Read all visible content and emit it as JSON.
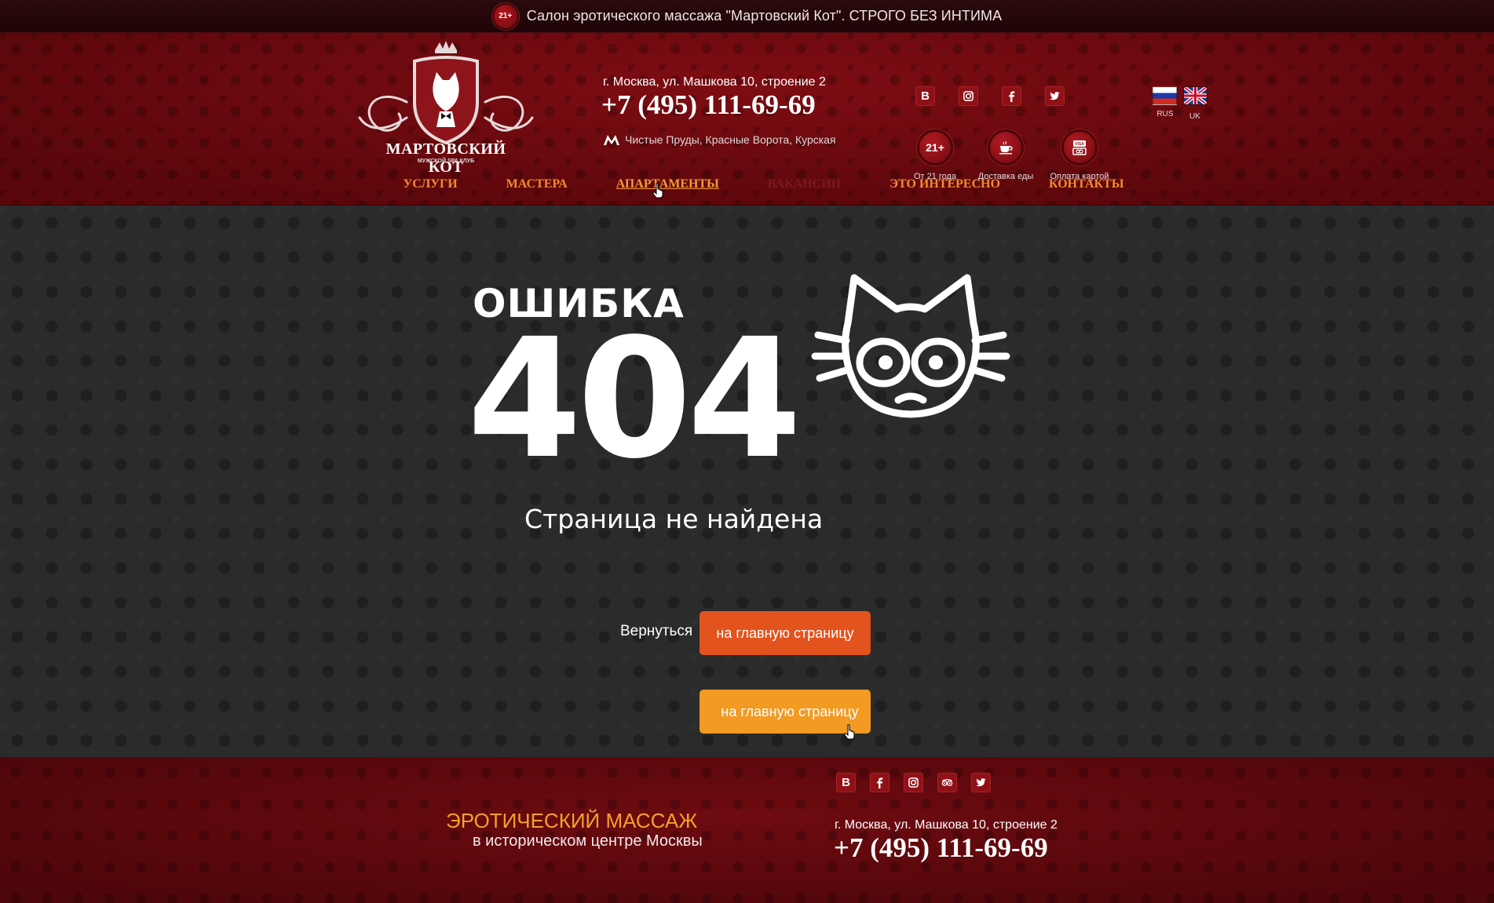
{
  "topbar": {
    "age_badge": "21+",
    "text": "Салон эротического массажа \"Мартовский Кот\". СТРОГО БЕЗ ИНТИМА"
  },
  "header": {
    "logo_title": "МАРТОВСКИЙ КОТ",
    "logo_subtitle": "МУЖСКОЙ SPA КЛУБ",
    "address": "г. Москва, ул. Машкова 10, строение 2",
    "phone": "+7 (495) 111-69-69",
    "metro": "Чистые Пруды, Красные Ворота, Курская",
    "social": [
      "vk-icon",
      "instagram-icon",
      "facebook-icon",
      "twitter-icon"
    ],
    "features": [
      {
        "icon": "21+",
        "label": "От 21 года"
      },
      {
        "icon": "coffee-cup-icon",
        "label": "Доставка еды"
      },
      {
        "icon": "visa-card-icon",
        "label": "Оплата картой"
      }
    ],
    "languages": [
      {
        "code": "RUS",
        "flag": "russia-flag-icon"
      },
      {
        "code": "UK",
        "flag": "uk-flag-icon"
      }
    ]
  },
  "nav": {
    "items": [
      {
        "label": "УСЛУГИ",
        "state": "normal"
      },
      {
        "label": "МАСТЕРА",
        "state": "normal"
      },
      {
        "label": "АПАРТАМЕНТЫ",
        "state": "hover"
      },
      {
        "label": "ВАКАНСИИ",
        "state": "disabled"
      },
      {
        "label": "ЭТО ИНТЕРЕСНО",
        "state": "normal"
      },
      {
        "label": "КОНТАКТЫ",
        "state": "normal"
      }
    ]
  },
  "error": {
    "title": "ОШИБКА",
    "code": "404",
    "subtitle": "Страница не найдена",
    "back_label": "Вернуться",
    "button_label": "на главную страницу",
    "button_hover_label": "на главную страницу"
  },
  "footer": {
    "tagline_main": "ЭРОТИЧЕСКИЙ МАССАЖ",
    "tagline_sub": "в историческом центре Москвы",
    "social": [
      "vk-icon",
      "facebook-icon",
      "instagram-icon",
      "tripadvisor-icon",
      "twitter-icon"
    ],
    "address": "г. Москва, ул. Машкова 10, строение 2",
    "phone": "+7 (495) 111-69-69"
  },
  "colors": {
    "brand_red": "#6a0b0f",
    "accent_orange": "#e2531e",
    "accent_orange_hover": "#f29a22",
    "nav_orange": "#f08c2e",
    "footer_tagline": "#f3a12a"
  }
}
